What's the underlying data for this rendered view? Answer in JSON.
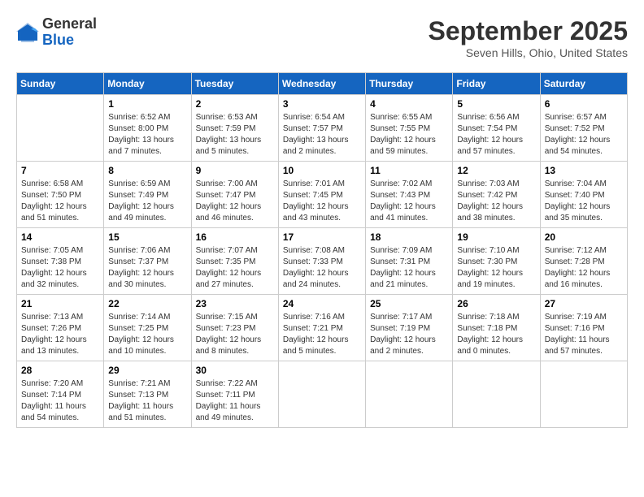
{
  "header": {
    "logo": {
      "line1": "General",
      "line2": "Blue"
    },
    "title": "September 2025",
    "location": "Seven Hills, Ohio, United States"
  },
  "weekdays": [
    "Sunday",
    "Monday",
    "Tuesday",
    "Wednesday",
    "Thursday",
    "Friday",
    "Saturday"
  ],
  "weeks": [
    [
      {
        "day": "",
        "info": ""
      },
      {
        "day": "1",
        "info": "Sunrise: 6:52 AM\nSunset: 8:00 PM\nDaylight: 13 hours\nand 7 minutes."
      },
      {
        "day": "2",
        "info": "Sunrise: 6:53 AM\nSunset: 7:59 PM\nDaylight: 13 hours\nand 5 minutes."
      },
      {
        "day": "3",
        "info": "Sunrise: 6:54 AM\nSunset: 7:57 PM\nDaylight: 13 hours\nand 2 minutes."
      },
      {
        "day": "4",
        "info": "Sunrise: 6:55 AM\nSunset: 7:55 PM\nDaylight: 12 hours\nand 59 minutes."
      },
      {
        "day": "5",
        "info": "Sunrise: 6:56 AM\nSunset: 7:54 PM\nDaylight: 12 hours\nand 57 minutes."
      },
      {
        "day": "6",
        "info": "Sunrise: 6:57 AM\nSunset: 7:52 PM\nDaylight: 12 hours\nand 54 minutes."
      }
    ],
    [
      {
        "day": "7",
        "info": "Sunrise: 6:58 AM\nSunset: 7:50 PM\nDaylight: 12 hours\nand 51 minutes."
      },
      {
        "day": "8",
        "info": "Sunrise: 6:59 AM\nSunset: 7:49 PM\nDaylight: 12 hours\nand 49 minutes."
      },
      {
        "day": "9",
        "info": "Sunrise: 7:00 AM\nSunset: 7:47 PM\nDaylight: 12 hours\nand 46 minutes."
      },
      {
        "day": "10",
        "info": "Sunrise: 7:01 AM\nSunset: 7:45 PM\nDaylight: 12 hours\nand 43 minutes."
      },
      {
        "day": "11",
        "info": "Sunrise: 7:02 AM\nSunset: 7:43 PM\nDaylight: 12 hours\nand 41 minutes."
      },
      {
        "day": "12",
        "info": "Sunrise: 7:03 AM\nSunset: 7:42 PM\nDaylight: 12 hours\nand 38 minutes."
      },
      {
        "day": "13",
        "info": "Sunrise: 7:04 AM\nSunset: 7:40 PM\nDaylight: 12 hours\nand 35 minutes."
      }
    ],
    [
      {
        "day": "14",
        "info": "Sunrise: 7:05 AM\nSunset: 7:38 PM\nDaylight: 12 hours\nand 32 minutes."
      },
      {
        "day": "15",
        "info": "Sunrise: 7:06 AM\nSunset: 7:37 PM\nDaylight: 12 hours\nand 30 minutes."
      },
      {
        "day": "16",
        "info": "Sunrise: 7:07 AM\nSunset: 7:35 PM\nDaylight: 12 hours\nand 27 minutes."
      },
      {
        "day": "17",
        "info": "Sunrise: 7:08 AM\nSunset: 7:33 PM\nDaylight: 12 hours\nand 24 minutes."
      },
      {
        "day": "18",
        "info": "Sunrise: 7:09 AM\nSunset: 7:31 PM\nDaylight: 12 hours\nand 21 minutes."
      },
      {
        "day": "19",
        "info": "Sunrise: 7:10 AM\nSunset: 7:30 PM\nDaylight: 12 hours\nand 19 minutes."
      },
      {
        "day": "20",
        "info": "Sunrise: 7:12 AM\nSunset: 7:28 PM\nDaylight: 12 hours\nand 16 minutes."
      }
    ],
    [
      {
        "day": "21",
        "info": "Sunrise: 7:13 AM\nSunset: 7:26 PM\nDaylight: 12 hours\nand 13 minutes."
      },
      {
        "day": "22",
        "info": "Sunrise: 7:14 AM\nSunset: 7:25 PM\nDaylight: 12 hours\nand 10 minutes."
      },
      {
        "day": "23",
        "info": "Sunrise: 7:15 AM\nSunset: 7:23 PM\nDaylight: 12 hours\nand 8 minutes."
      },
      {
        "day": "24",
        "info": "Sunrise: 7:16 AM\nSunset: 7:21 PM\nDaylight: 12 hours\nand 5 minutes."
      },
      {
        "day": "25",
        "info": "Sunrise: 7:17 AM\nSunset: 7:19 PM\nDaylight: 12 hours\nand 2 minutes."
      },
      {
        "day": "26",
        "info": "Sunrise: 7:18 AM\nSunset: 7:18 PM\nDaylight: 12 hours\nand 0 minutes."
      },
      {
        "day": "27",
        "info": "Sunrise: 7:19 AM\nSunset: 7:16 PM\nDaylight: 11 hours\nand 57 minutes."
      }
    ],
    [
      {
        "day": "28",
        "info": "Sunrise: 7:20 AM\nSunset: 7:14 PM\nDaylight: 11 hours\nand 54 minutes."
      },
      {
        "day": "29",
        "info": "Sunrise: 7:21 AM\nSunset: 7:13 PM\nDaylight: 11 hours\nand 51 minutes."
      },
      {
        "day": "30",
        "info": "Sunrise: 7:22 AM\nSunset: 7:11 PM\nDaylight: 11 hours\nand 49 minutes."
      },
      {
        "day": "",
        "info": ""
      },
      {
        "day": "",
        "info": ""
      },
      {
        "day": "",
        "info": ""
      },
      {
        "day": "",
        "info": ""
      }
    ]
  ]
}
